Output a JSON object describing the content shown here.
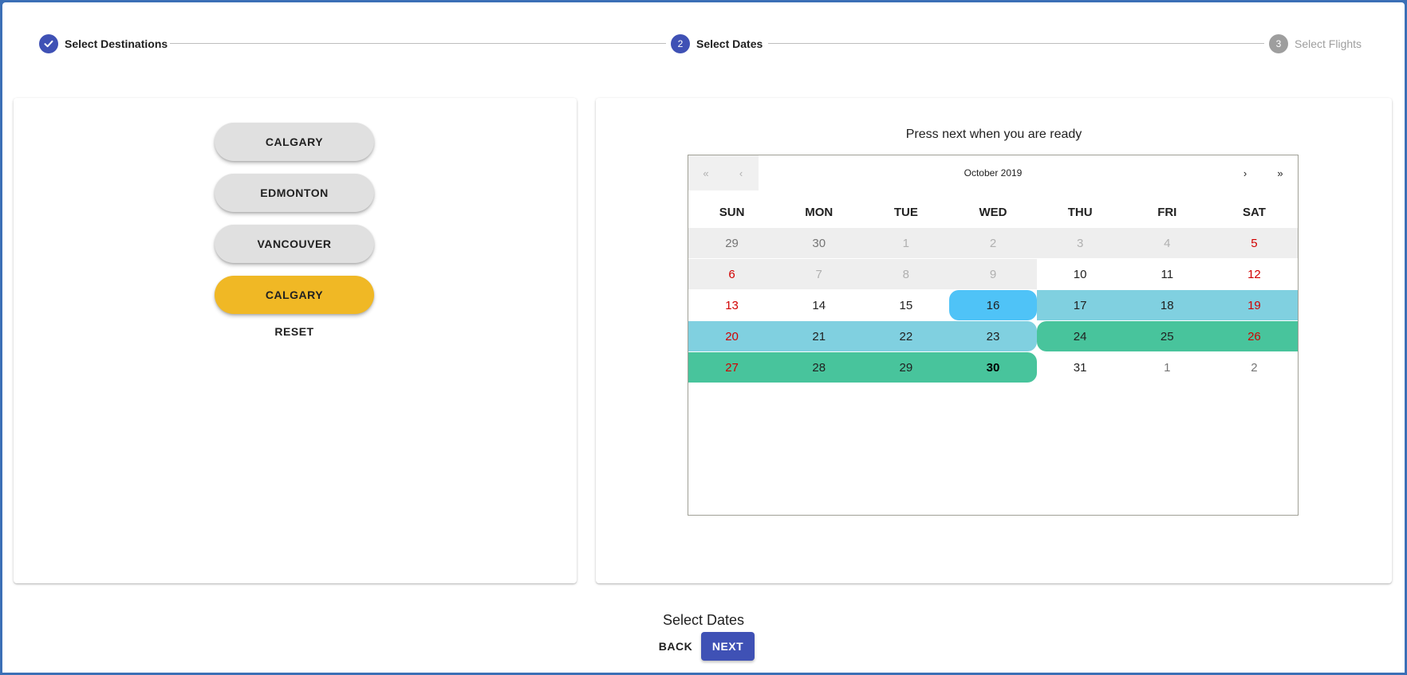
{
  "stepper": {
    "steps": [
      {
        "index": "",
        "label": "Select Destinations",
        "state": "done"
      },
      {
        "index": "2",
        "label": "Select Dates",
        "state": "active"
      },
      {
        "index": "3",
        "label": "Select Flights",
        "state": "pending"
      }
    ]
  },
  "destinations": {
    "buttons": [
      "CALGARY",
      "EDMONTON",
      "VANCOUVER",
      "CALGARY"
    ],
    "selected_index": 3,
    "reset_label": "RESET"
  },
  "calendar": {
    "prompt": "Press next when you are ready",
    "nav": {
      "prev2": "«",
      "prev": "‹",
      "next": "›",
      "next2": "»"
    },
    "month_label": "October 2019",
    "weekdays": [
      "SUN",
      "MON",
      "TUE",
      "WED",
      "THU",
      "FRI",
      "SAT"
    ],
    "weeks": [
      [
        "29",
        "30",
        "1",
        "2",
        "3",
        "4",
        "5"
      ],
      [
        "6",
        "7",
        "8",
        "9",
        "10",
        "11",
        "12"
      ],
      [
        "13",
        "14",
        "15",
        "16",
        "17",
        "18",
        "19"
      ],
      [
        "20",
        "21",
        "22",
        "23",
        "24",
        "25",
        "26"
      ],
      [
        "27",
        "28",
        "29",
        "30",
        "31",
        "1",
        "2"
      ]
    ]
  },
  "footer": {
    "title": "Select Dates",
    "back_label": "BACK",
    "next_label": "NEXT"
  },
  "colors": {
    "primary": "#3f51b5",
    "selected_destination": "#f0b825",
    "range_start": "#4fc3f7",
    "range_leg1": "#80d0e0",
    "range_leg2": "#48c49c",
    "weekend_text": "#d10000"
  }
}
